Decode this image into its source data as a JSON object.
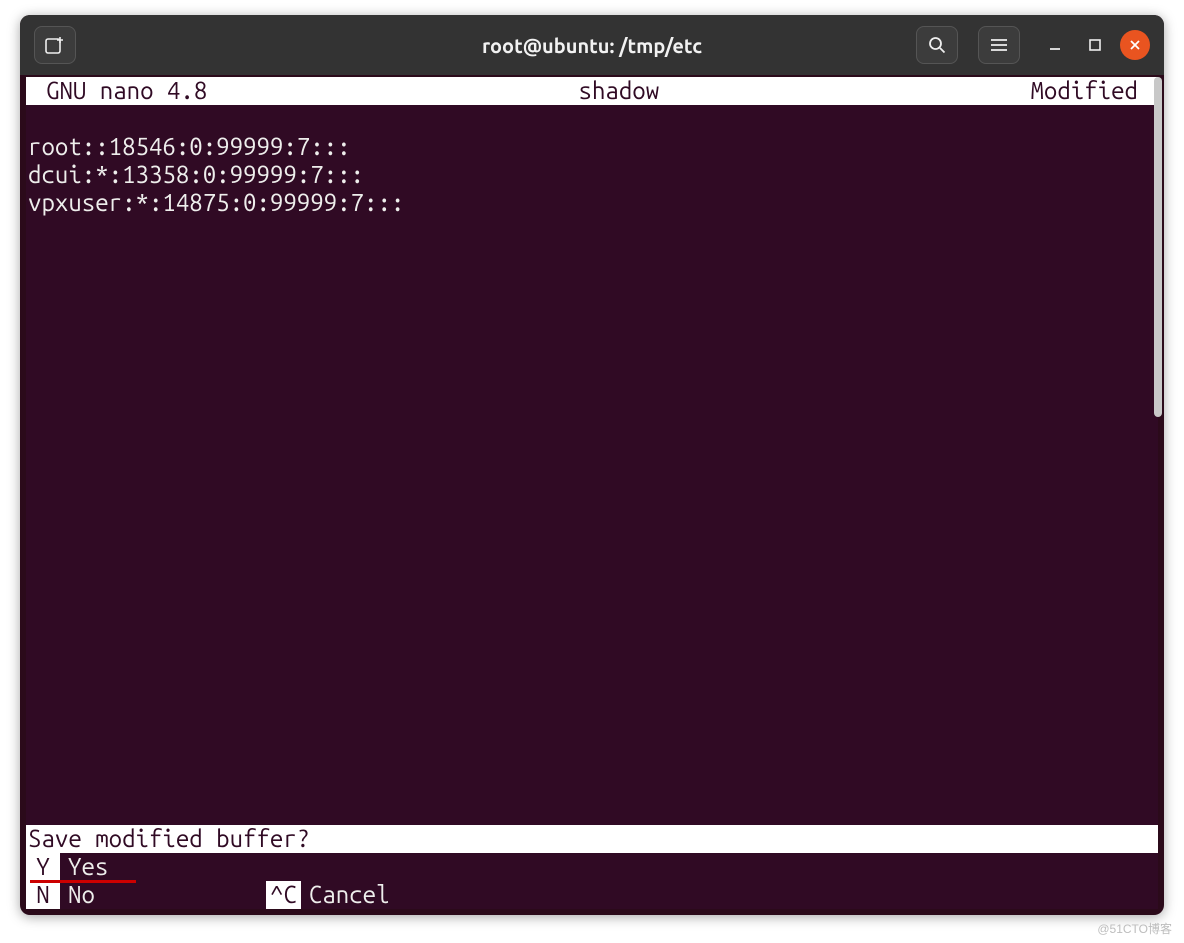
{
  "window": {
    "title": "root@ubuntu: /tmp/etc"
  },
  "nano": {
    "header": {
      "app": "GNU nano 4.8",
      "filename": "shadow",
      "status": "Modified"
    },
    "content": {
      "line1": "root::18546:0:99999:7:::",
      "line2": "dcui:*:13358:0:99999:7:::",
      "line3": "vpxuser:*:14875:0:99999:7:::"
    },
    "prompt": "Save modified buffer?",
    "options": {
      "yes_key": " Y",
      "yes_label": "Yes",
      "no_key": " N",
      "no_label": "No",
      "cancel_key": "^C",
      "cancel_label": "Cancel"
    }
  },
  "watermark": "@51CTO博客"
}
